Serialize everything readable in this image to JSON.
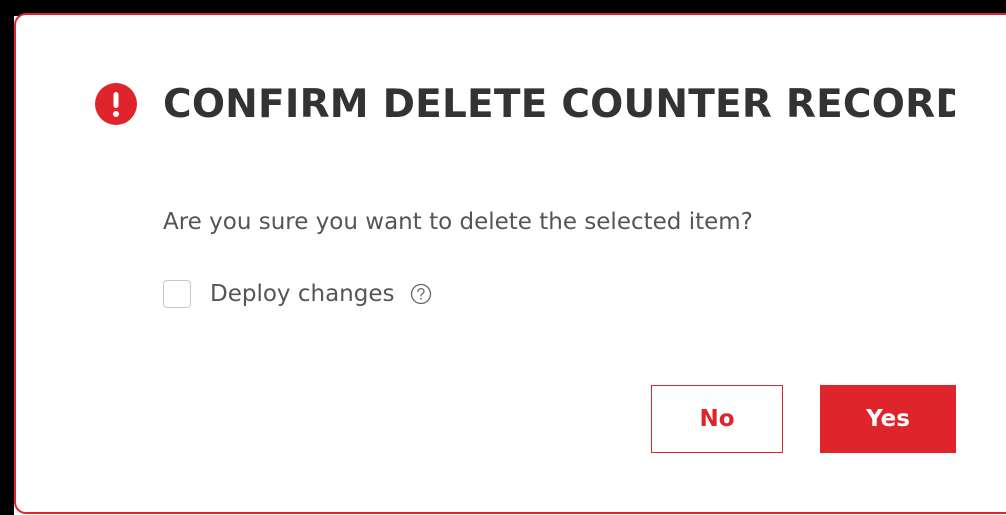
{
  "dialog": {
    "title": "CONFIRM DELETE COUNTER RECORD",
    "message": "Are you sure you want to delete the selected item?",
    "deploy_label": "Deploy changes",
    "deploy_checked": false,
    "no_label": "No",
    "yes_label": "Yes",
    "alert_icon": "exclamation-circle-icon",
    "help_icon": "question-circle-icon"
  },
  "colors": {
    "accent": "#e0242b",
    "title_text": "#333333",
    "body_text": "#555555",
    "checkbox_border": "#c8c8c8"
  }
}
